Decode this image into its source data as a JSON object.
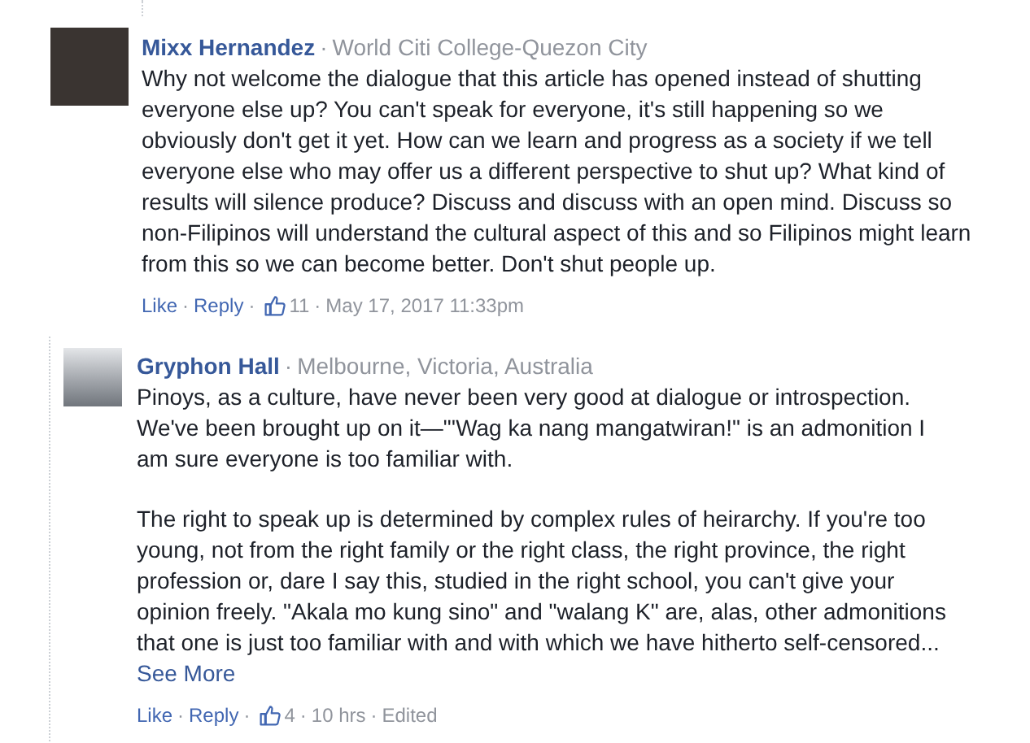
{
  "comments": [
    {
      "author": "Mixx Hernandez",
      "separator": "·",
      "affiliation": "World Citi College-Quezon City",
      "paragraphs": [
        "Why not welcome the dialogue that this article has opened instead of shutting everyone else up? You can't speak for everyone, it's still happening so we obviously don't get it yet. How can we learn and progress as a society if we tell everyone else who may offer us a different perspective to shut up? What kind of results will silence produce? Discuss and discuss with an open mind. Discuss so non-Filipinos will understand the cultural aspect of this and so Filipinos might learn from this so we can become better. Don't shut people up."
      ],
      "actions": [
        "Like",
        "Reply"
      ],
      "likes": "11",
      "time": "May 17, 2017 11:33pm",
      "replies": [
        {
          "author": "Gryphon Hall",
          "separator": "·",
          "affiliation": "Melbourne, Victoria, Australia",
          "paragraphs": [
            "Pinoys, as a culture, have never been very good at dialogue or introspection. We've been brought up on it—\"'Wag ka nang mangatwiran!\" is an admonition I am sure everyone is too familiar with.",
            "The right to speak up is determined by complex rules of heirarchy. If you're too young, not from the right family or the right class, the right province, the right profession or, dare I say this, studied in the right school, you can't give your opinion freely. \"Akala mo kung sino\" and \"walang K\" are, alas, other admonitions that one is just too familiar with and with which we have hitherto self-censored..."
          ],
          "see_more": "See More",
          "actions": [
            "Like",
            "Reply"
          ],
          "likes": "4",
          "time": "10 hrs",
          "edited": "Edited"
        }
      ]
    }
  ]
}
